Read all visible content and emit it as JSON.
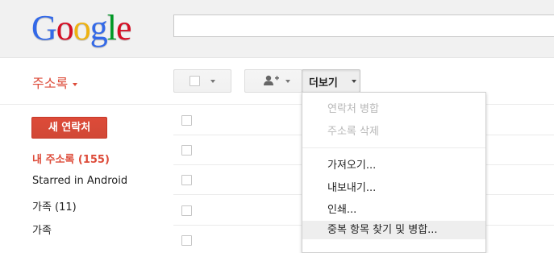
{
  "header": {
    "logo": {
      "letters": [
        {
          "ch": "G",
          "color": "#3369e8"
        },
        {
          "ch": "o",
          "color": "#d50f25"
        },
        {
          "ch": "o",
          "color": "#eeb211"
        },
        {
          "ch": "g",
          "color": "#3369e8"
        },
        {
          "ch": "l",
          "color": "#009925"
        },
        {
          "ch": "e",
          "color": "#d50f25"
        }
      ]
    },
    "search": {
      "value": "",
      "placeholder": ""
    }
  },
  "toolbar": {
    "app_title": "주소록",
    "more_label": "더보기",
    "icons": {
      "select": "checkbox-icon",
      "add": "add-person-icon"
    }
  },
  "sidebar": {
    "new_contact": "새 연락처",
    "items": [
      {
        "label": "내 주소록 (155)",
        "active": true
      },
      {
        "label": "Starred in Android",
        "active": false
      },
      {
        "label": "가족 (11)",
        "active": false
      },
      {
        "label": "가족",
        "active": false
      }
    ]
  },
  "menu": {
    "items": [
      {
        "label": "연락처 병합",
        "disabled": true
      },
      {
        "label": "주소록 삭제",
        "disabled": true
      },
      {
        "label": "가져오기...",
        "disabled": false
      },
      {
        "label": "내보내기...",
        "disabled": false
      },
      {
        "label": "인쇄...",
        "disabled": false
      },
      {
        "label": "중복 항목 찾기 및 병합...",
        "disabled": false,
        "hover": true
      }
    ]
  },
  "colors": {
    "accent": "#dd4b39",
    "disabled_text": "#b8b8b8"
  }
}
